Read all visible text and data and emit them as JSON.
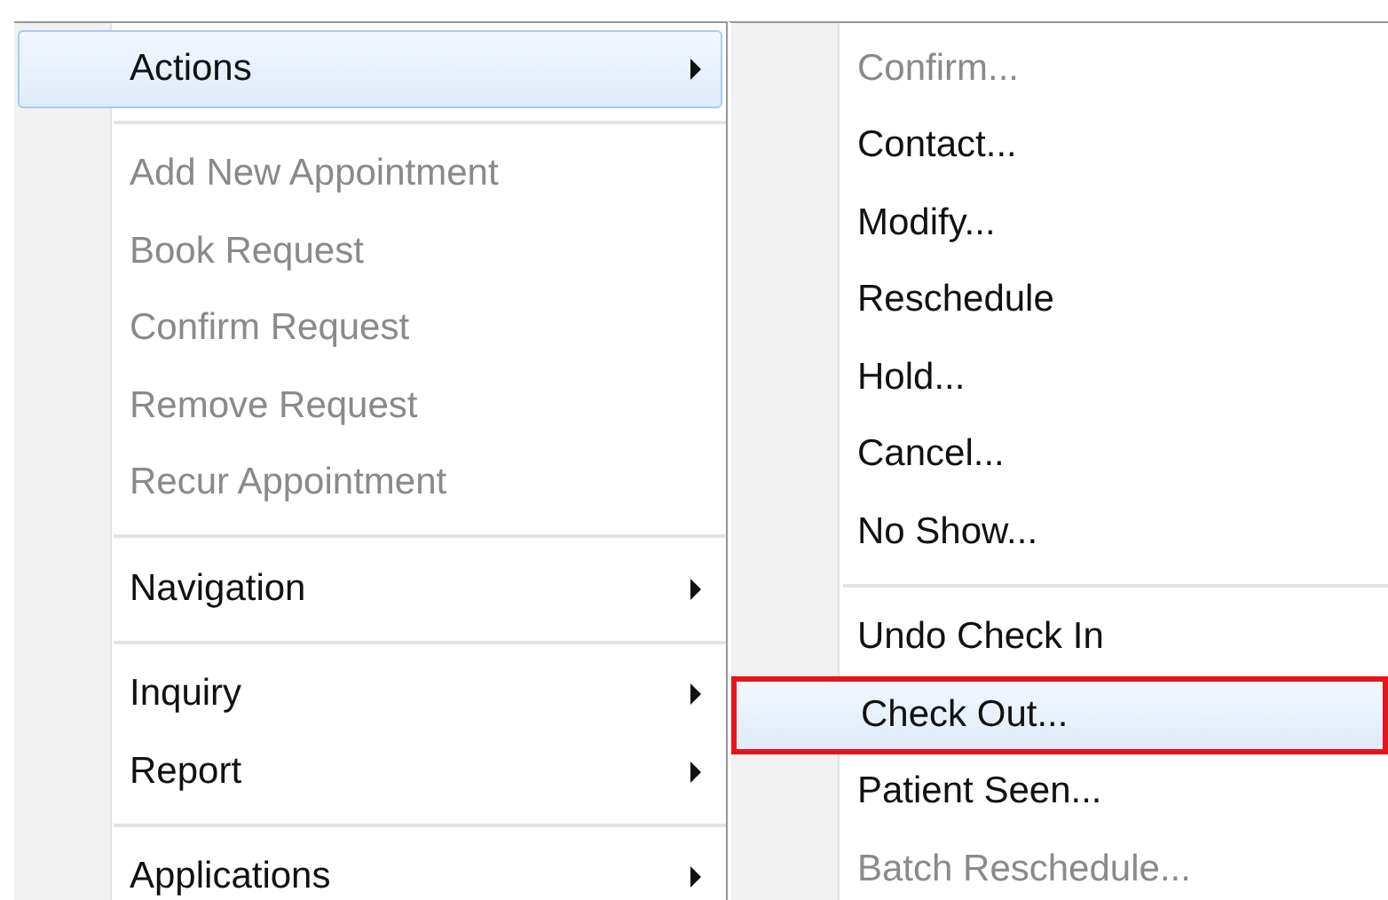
{
  "menu": {
    "items": [
      {
        "kind": "item",
        "label": "Actions",
        "disabled": false,
        "selected": true,
        "submenu": true
      },
      {
        "kind": "separator"
      },
      {
        "kind": "item",
        "label": "Add New Appointment",
        "disabled": true,
        "selected": false,
        "submenu": false
      },
      {
        "kind": "item",
        "label": "Book Request",
        "disabled": true,
        "selected": false,
        "submenu": false
      },
      {
        "kind": "item",
        "label": "Confirm Request",
        "disabled": true,
        "selected": false,
        "submenu": false
      },
      {
        "kind": "item",
        "label": "Remove Request",
        "disabled": true,
        "selected": false,
        "submenu": false
      },
      {
        "kind": "item",
        "label": "Recur Appointment",
        "disabled": true,
        "selected": false,
        "submenu": false
      },
      {
        "kind": "separator"
      },
      {
        "kind": "item",
        "label": "Navigation",
        "disabled": false,
        "selected": false,
        "submenu": true
      },
      {
        "kind": "separator"
      },
      {
        "kind": "item",
        "label": "Inquiry",
        "disabled": false,
        "selected": false,
        "submenu": true
      },
      {
        "kind": "item",
        "label": "Report",
        "disabled": false,
        "selected": false,
        "submenu": true
      },
      {
        "kind": "separator"
      },
      {
        "kind": "item",
        "label": "Applications",
        "disabled": false,
        "selected": false,
        "submenu": true
      }
    ]
  },
  "submenu": {
    "items": [
      {
        "kind": "item",
        "label": "Confirm...",
        "disabled": true,
        "selected": false,
        "outlined": false
      },
      {
        "kind": "item",
        "label": "Contact...",
        "disabled": false,
        "selected": false,
        "outlined": false
      },
      {
        "kind": "item",
        "label": "Modify...",
        "disabled": false,
        "selected": false,
        "outlined": false
      },
      {
        "kind": "item",
        "label": "Reschedule",
        "disabled": false,
        "selected": false,
        "outlined": false
      },
      {
        "kind": "item",
        "label": "Hold...",
        "disabled": false,
        "selected": false,
        "outlined": false
      },
      {
        "kind": "item",
        "label": "Cancel...",
        "disabled": false,
        "selected": false,
        "outlined": false
      },
      {
        "kind": "item",
        "label": "No Show...",
        "disabled": false,
        "selected": false,
        "outlined": false
      },
      {
        "kind": "separator"
      },
      {
        "kind": "item",
        "label": "Undo Check In",
        "disabled": false,
        "selected": false,
        "outlined": false
      },
      {
        "kind": "item",
        "label": "Check Out...",
        "disabled": false,
        "selected": true,
        "outlined": true
      },
      {
        "kind": "item",
        "label": "Patient Seen...",
        "disabled": false,
        "selected": false,
        "outlined": false
      },
      {
        "kind": "item",
        "label": "Batch Reschedule...",
        "disabled": true,
        "selected": false,
        "outlined": false
      }
    ]
  }
}
